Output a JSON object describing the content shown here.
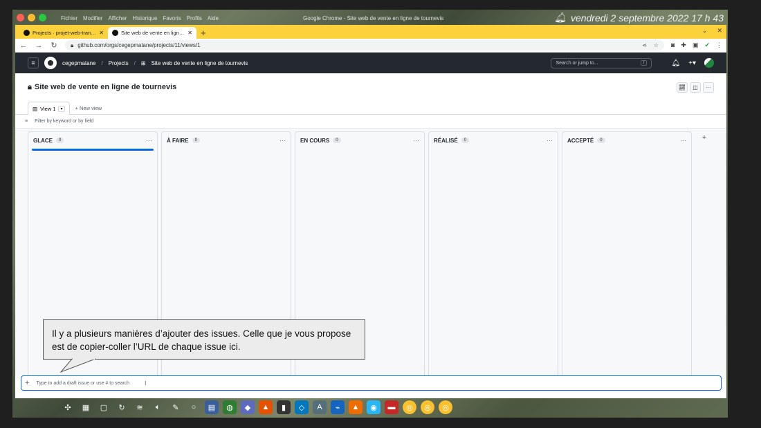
{
  "os": {
    "menus": [
      "Fichier",
      "Modifier",
      "Afficher",
      "Historique",
      "Favoris",
      "Profils",
      "Aide"
    ],
    "window_title": "Google Chrome - Site web de vente en ligne de tournevis",
    "clock": "vendredi 2 septembre 2022  17 h 43"
  },
  "browser": {
    "tabs": [
      {
        "label": "Projects · projet-web-transac",
        "close": "✕"
      },
      {
        "label": "Site web de vente en ligne de",
        "close": "✕"
      }
    ],
    "new_tab": "+",
    "url": "github.com/orgs/cegepmatane/projects/11/views/1"
  },
  "github": {
    "org": "cegepmatane",
    "projects_label": "Projects",
    "project_crumb": "Site web de vente en ligne de tournevis",
    "search_placeholder": "Search or jump to...",
    "search_key": "/"
  },
  "project": {
    "title": "Site web de vente en ligne de tournevis",
    "view_tab": "View 1",
    "new_view": "New view",
    "filter_placeholder": "Filter by keyword or by field",
    "columns": [
      {
        "name": "GLACE",
        "count": "0",
        "menu": "···"
      },
      {
        "name": "À FAIRE",
        "count": "0",
        "menu": "···"
      },
      {
        "name": "EN COURS",
        "count": "0",
        "menu": "···"
      },
      {
        "name": "RÉALISÉ",
        "count": "0",
        "menu": "···"
      },
      {
        "name": "ACCEPTÉ",
        "count": "0",
        "menu": "···"
      }
    ],
    "add_column": "+",
    "draft_placeholder": "Type to add a draft issue or use # to search"
  },
  "callout": {
    "text": "Il y a plusieurs manières d’ajouter des issues.  Celle que je vous propose est de copier-coller l’URL de chaque issue ici."
  },
  "colors": {
    "tabstrip": "#fbd13c",
    "gh_header": "#24292f",
    "accent": "#0969da"
  }
}
